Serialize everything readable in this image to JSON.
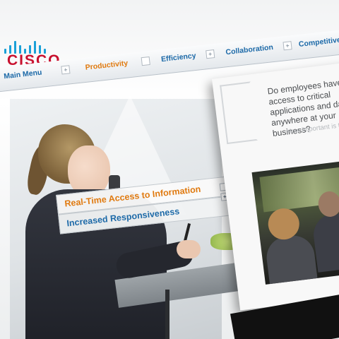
{
  "brand": {
    "logo_text": "CISCO",
    "colors": {
      "logo_bars": "#1ba0d7",
      "logo_text": "#c8102e"
    }
  },
  "nav": {
    "main_menu_label": "Main Menu",
    "tabs": [
      {
        "label": "Productivity",
        "active": true
      },
      {
        "label": "Efficiency",
        "active": false
      },
      {
        "label": "Collaboration",
        "active": false
      },
      {
        "label": "Competitive A",
        "active": false
      }
    ],
    "colors": {
      "active": "#e07a10",
      "inactive": "#1d6aa8"
    }
  },
  "submenu": {
    "items": [
      {
        "label": "Real-Time Access to Information",
        "active": true
      },
      {
        "label": "Increased Responsiveness",
        "active": false
      }
    ]
  },
  "panel": {
    "question": "Do employees have access to critical applications and data anywhere at your business?",
    "subtext": "How important is this?"
  }
}
